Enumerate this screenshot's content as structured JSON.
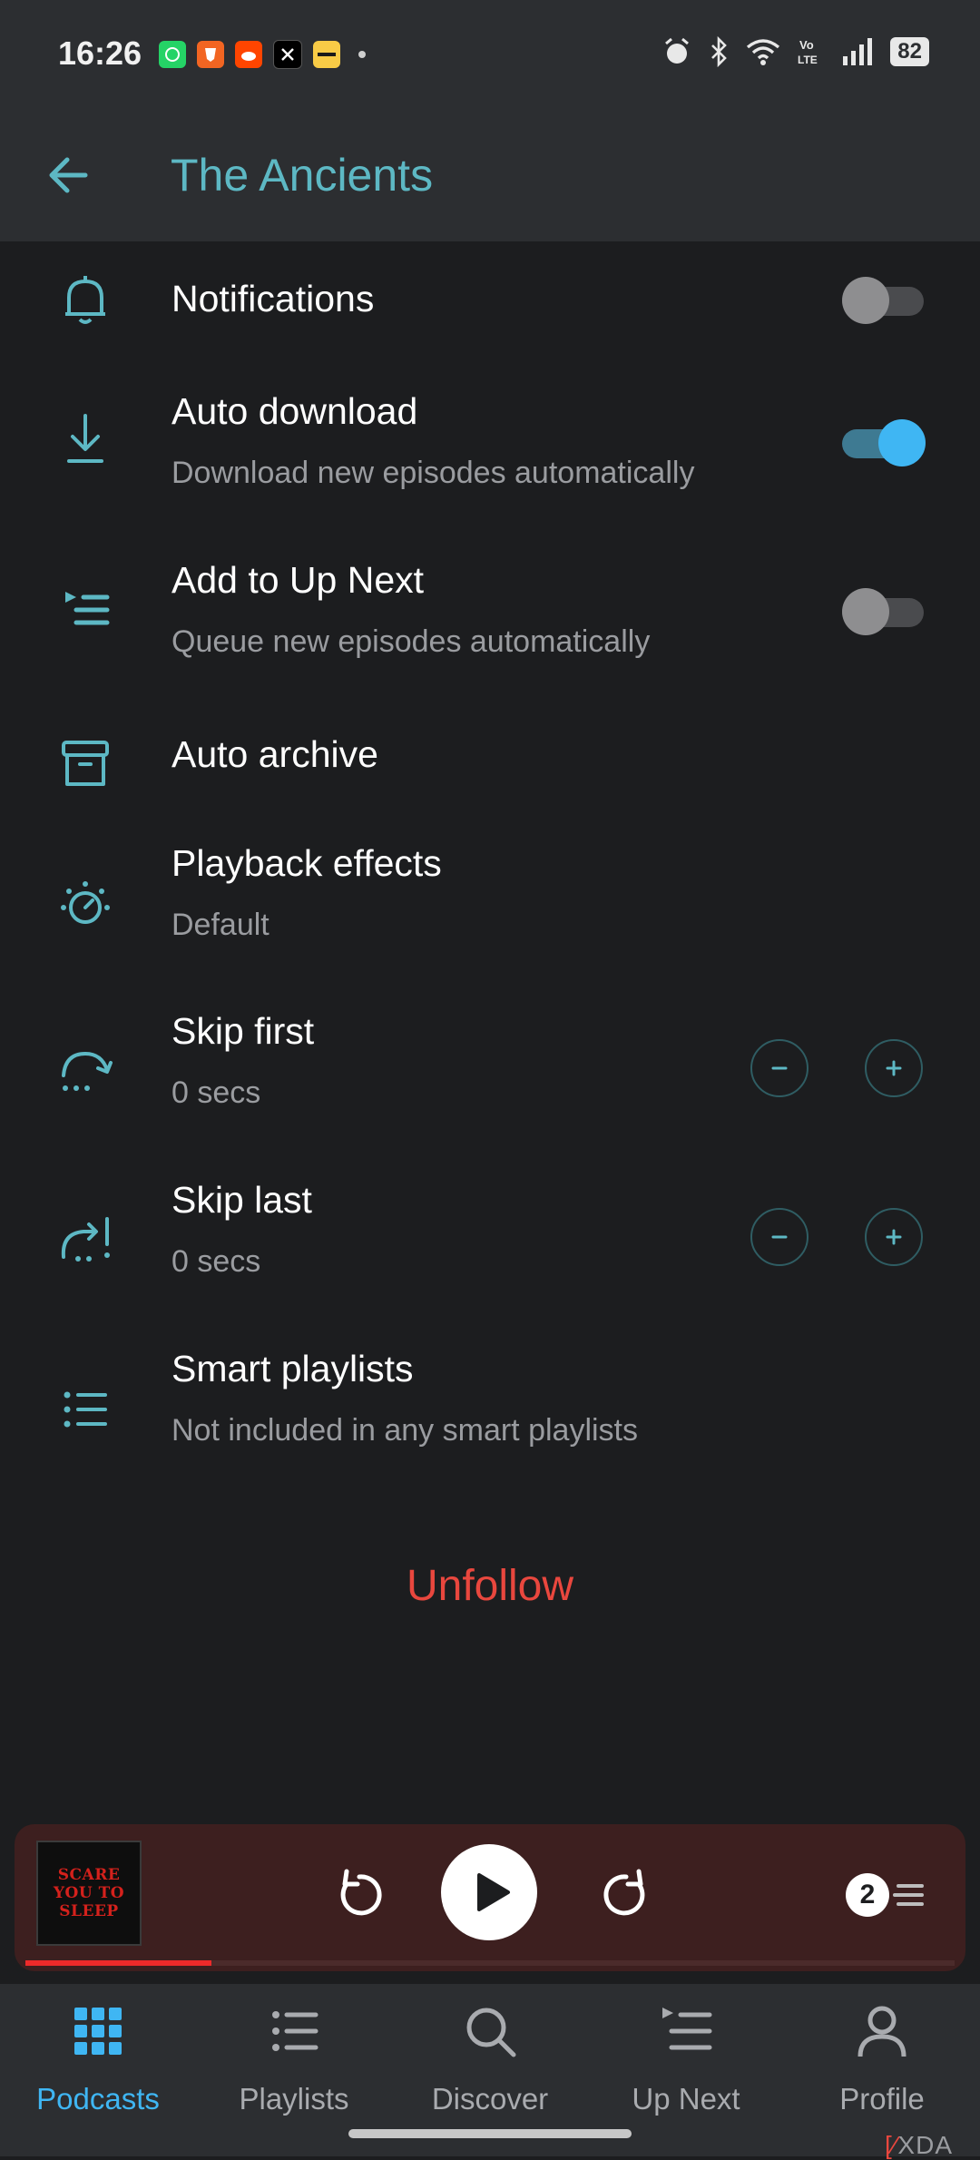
{
  "status_bar": {
    "time": "16:26",
    "battery": "82",
    "notification_icons": [
      "whatsapp-icon",
      "brave-icon",
      "reddit-icon",
      "x-icon",
      "blinkit-icon"
    ],
    "system_icons": [
      "alarm-icon",
      "bluetooth-icon",
      "wifi-icon",
      "volte-icon",
      "signal-icon"
    ]
  },
  "header": {
    "title": "The Ancients"
  },
  "settings": {
    "notifications": {
      "title": "Notifications",
      "enabled": false
    },
    "auto_download": {
      "title": "Auto download",
      "subtitle": "Download new episodes automatically",
      "enabled": true
    },
    "add_to_up_next": {
      "title": "Add to Up Next",
      "subtitle": "Queue new episodes automatically",
      "enabled": false
    },
    "auto_archive": {
      "title": "Auto archive"
    },
    "playback_effects": {
      "title": "Playback effects",
      "subtitle": "Default"
    },
    "skip_first": {
      "title": "Skip first",
      "subtitle": "0 secs"
    },
    "skip_last": {
      "title": "Skip last",
      "subtitle": "0 secs"
    },
    "smart_playlists": {
      "title": "Smart playlists",
      "subtitle": "Not included in any smart playlists"
    }
  },
  "unfollow_label": "Unfollow",
  "mini_player": {
    "artwork_text": [
      "SCARE",
      "YOU TO",
      "SLEEP"
    ],
    "queue_count": "2",
    "progress": 0.2
  },
  "bottom_nav": {
    "podcasts": "Podcasts",
    "playlists": "Playlists",
    "discover": "Discover",
    "up_next": "Up Next",
    "profile": "Profile"
  },
  "watermark": "XDA",
  "colors": {
    "accent": "#5db8c4",
    "toggle_on": "#3fb6f3",
    "unfollow": "#e9473e",
    "player_bg": "#3d1f1f",
    "progress": "#ee2a2a"
  }
}
